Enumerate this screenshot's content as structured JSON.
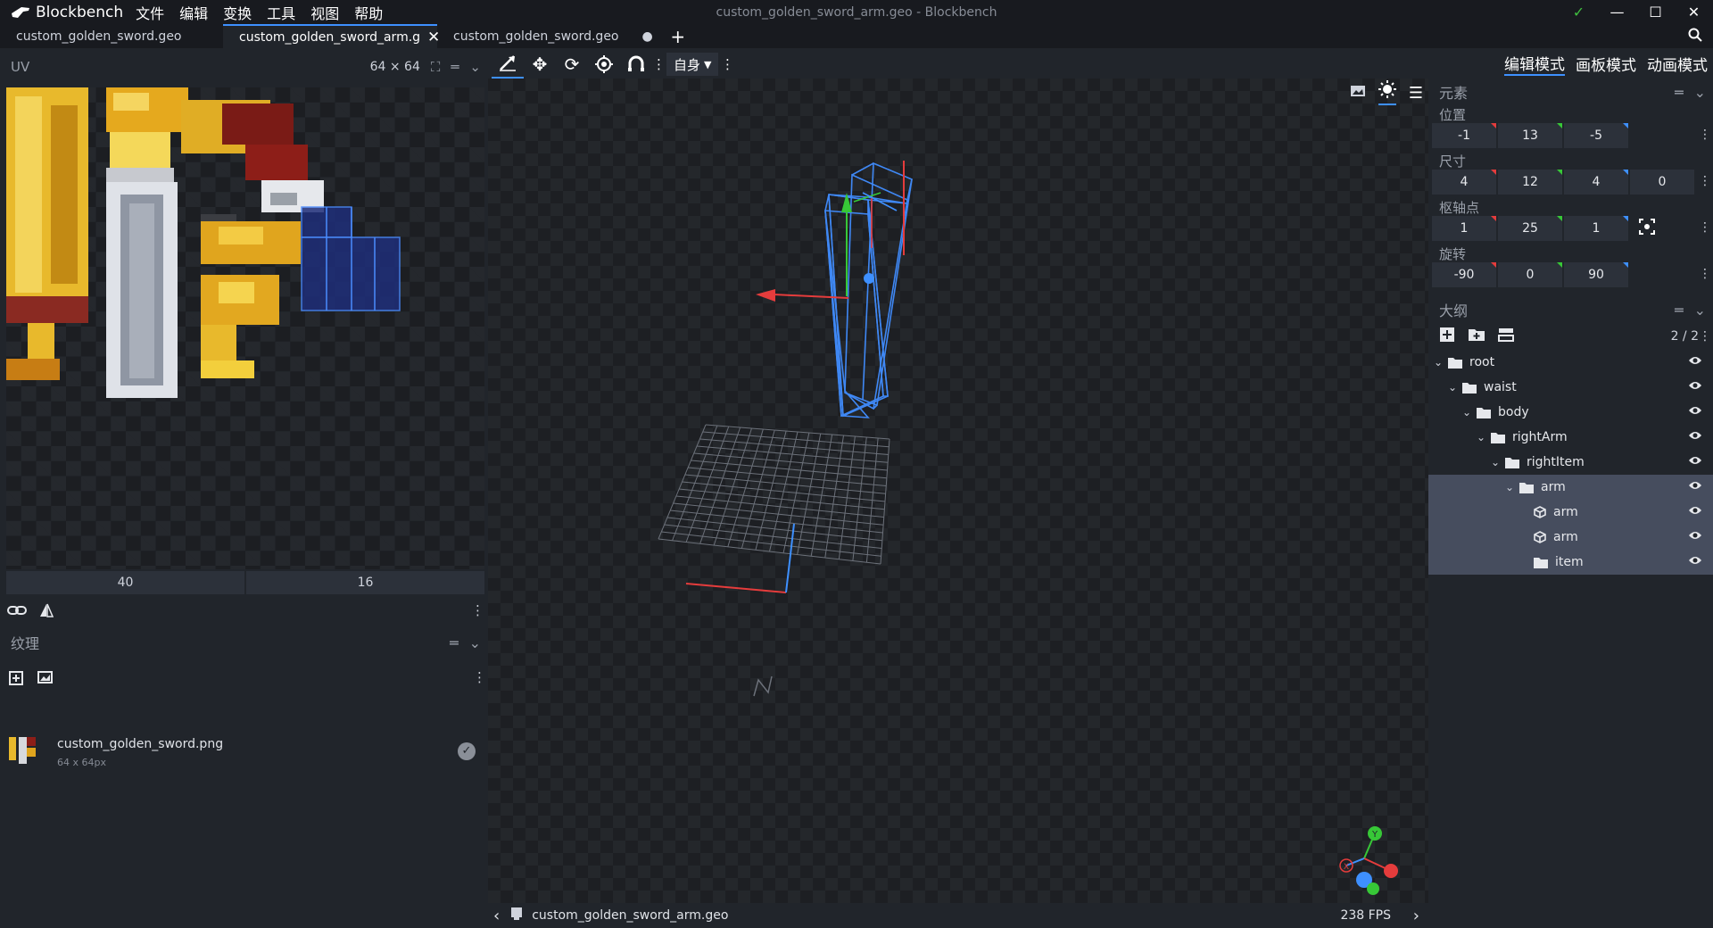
{
  "app": {
    "name": "Blockbench",
    "window_title": "custom_golden_sword_arm.geo - Blockbench"
  },
  "menu": [
    "文件",
    "编辑",
    "变换",
    "工具",
    "视图",
    "帮助"
  ],
  "tabs": [
    {
      "label": "custom_golden_sword.geo"
    },
    {
      "label": "custom_golden_sword_arm.g"
    },
    {
      "label": "custom_golden_sword.geo"
    }
  ],
  "uv_panel": {
    "title": "UV",
    "size": "64 × 64",
    "inputs": [
      "40",
      "16"
    ]
  },
  "toolbar": {
    "space_select": "自身"
  },
  "textures": {
    "title": "纹理",
    "items": [
      {
        "name": "custom_golden_sword.png",
        "size": "64 x 64px"
      }
    ]
  },
  "modes": [
    "编辑模式",
    "画板模式",
    "动画模式"
  ],
  "element": {
    "title": "元素",
    "position": {
      "label": "位置",
      "values": [
        "-1",
        "13",
        "-5"
      ]
    },
    "size": {
      "label": "尺寸",
      "values": [
        "4",
        "12",
        "4"
      ],
      "inflate": "0"
    },
    "pivot": {
      "label": "枢轴点",
      "values": [
        "1",
        "25",
        "1"
      ]
    },
    "rotation": {
      "label": "旋转",
      "values": [
        "-90",
        "0",
        "90"
      ]
    }
  },
  "outliner": {
    "title": "大纲",
    "count": "2 / 2",
    "nodes": [
      {
        "label": "root",
        "type": "group",
        "depth": 0
      },
      {
        "label": "waist",
        "type": "group",
        "depth": 1
      },
      {
        "label": "body",
        "type": "group",
        "depth": 2
      },
      {
        "label": "rightArm",
        "type": "group",
        "depth": 3
      },
      {
        "label": "rightItem",
        "type": "group",
        "depth": 4
      },
      {
        "label": "arm",
        "type": "group",
        "depth": 5,
        "selected": true
      },
      {
        "label": "arm",
        "type": "cube",
        "depth": 6,
        "selected": true
      },
      {
        "label": "arm",
        "type": "cube",
        "depth": 6,
        "selected": true
      },
      {
        "label": "item",
        "type": "folder",
        "depth": 6,
        "selected": true
      }
    ]
  },
  "status": {
    "file": "custom_golden_sword_arm.geo",
    "fps": "238 FPS"
  },
  "colors": {
    "accent": "#3e90ff",
    "x_axis": "#e53c3c",
    "y_axis": "#37c837",
    "z_axis": "#3e90ff",
    "check": "#3fbf3f"
  }
}
